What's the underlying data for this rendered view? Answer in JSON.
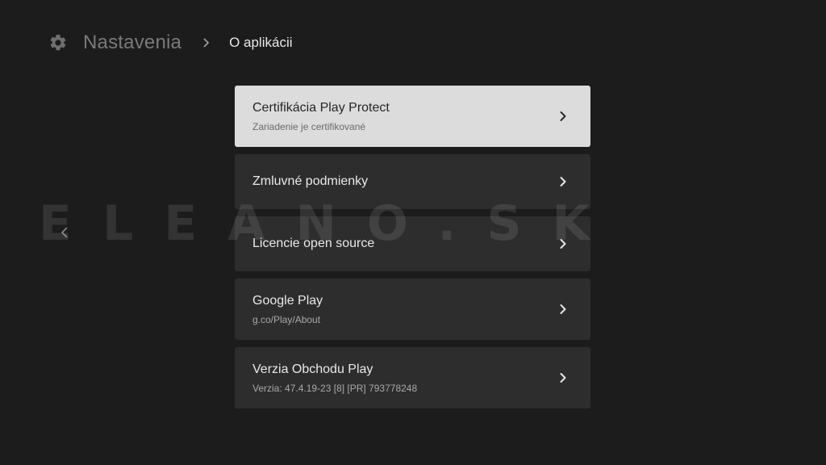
{
  "header": {
    "icon": "gear-icon",
    "root_label": "Nastavenia",
    "current_label": "O aplikácii"
  },
  "items": [
    {
      "title": "Certifikácia Play Protect",
      "subtitle": "Zariadenie je certifikované"
    },
    {
      "title": "Zmluvné podmienky"
    },
    {
      "title": "Licencie open source"
    },
    {
      "title": "Google Play",
      "subtitle": "g.co/Play/About"
    },
    {
      "title": "Verzia Obchodu Play",
      "subtitle": "Verzia: 47.4.19-23 [8] [PR] 793778248"
    }
  ],
  "watermark": {
    "text": "ELEANO.SK"
  },
  "colors": {
    "background": "#1c1c1c",
    "card": "#2d2d2d",
    "card_focused": "#dcdcdc"
  }
}
